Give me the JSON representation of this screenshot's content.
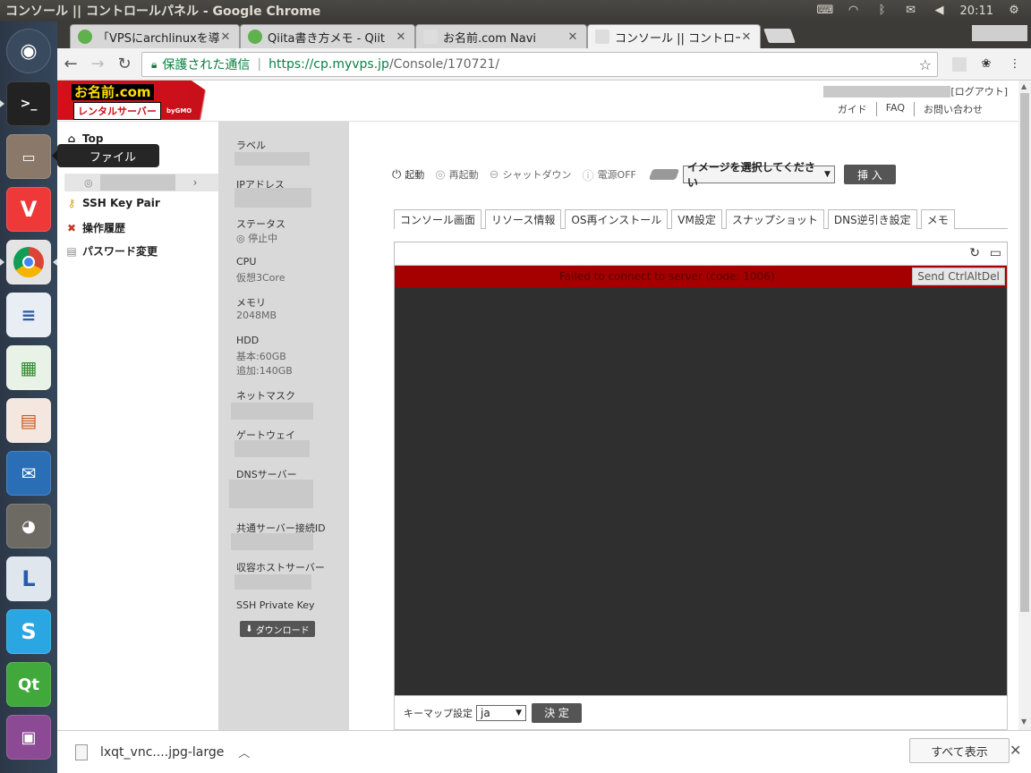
{
  "window": {
    "title": "コンソール || コントロールパネル - Google Chrome"
  },
  "panel": {
    "clock": "20:11"
  },
  "launcher": {
    "tooltip": "ファイル"
  },
  "tabs": [
    {
      "title": "「VPSにarchlinuxを導",
      "fav_color": "#5eb14c"
    },
    {
      "title": "Qiita書き方メモ - Qiit",
      "fav_color": "#5eb14c"
    },
    {
      "title": "お名前.com Navi",
      "fav_color": "#cccccc"
    },
    {
      "title": "コンソール || コントロー",
      "fav_color": "#cccccc"
    }
  ],
  "omnibox": {
    "secure_label": "保護された通信",
    "url_host": "https://cp.myvps.jp",
    "url_path": "/Console/170721/"
  },
  "header": {
    "logo_brand": "お名前.com",
    "logo_sub": "レンタルサーバー",
    "logo_gmo": "byGMO",
    "logout": "[ログアウト]",
    "links": [
      "ガイド",
      "FAQ",
      "お問い合わせ"
    ]
  },
  "menu": {
    "top": "Top",
    "ssh_key_pair": "SSH Key Pair",
    "history": "操作履歴",
    "password": "パスワード変更"
  },
  "info": {
    "label": "ラベル",
    "ip": "IPアドレス",
    "status_label": "ステータス",
    "status_value": "◎ 停止中",
    "cpu_label": "CPU",
    "cpu_value": "仮想3Core",
    "memory_label": "メモリ",
    "memory_value": "2048MB",
    "hdd_label": "HDD",
    "hdd_base": "基本:60GB",
    "hdd_extra": "追加:140GB",
    "netmask": "ネットマスク",
    "gateway": "ゲートウェイ",
    "dns": "DNSサーバー",
    "shared_id": "共通サーバー接続ID",
    "host": "収容ホストサーバー",
    "ssh_private": "SSH Private Key",
    "download": "ダウンロード"
  },
  "power": {
    "start": "起動",
    "restart": "再起動",
    "shutdown": "シャットダウン",
    "poweroff": "電源OFF",
    "image_select": "イメージを選択してください",
    "insert": "挿 入"
  },
  "content_tabs": [
    "コンソール画面",
    "リソース情報",
    "OS再インストール",
    "VM設定",
    "スナップショット",
    "DNS逆引き設定",
    "メモ"
  ],
  "console": {
    "error": "Failed to connect to server (code: 1006)",
    "send_cad": "Send CtrlAltDel",
    "keymap_label": "キーマップ設定",
    "keymap_value": "ja",
    "apply": "決 定"
  },
  "shelf": {
    "filename": "lxqt_vnc....jpg-large",
    "show_all": "すべて表示"
  }
}
